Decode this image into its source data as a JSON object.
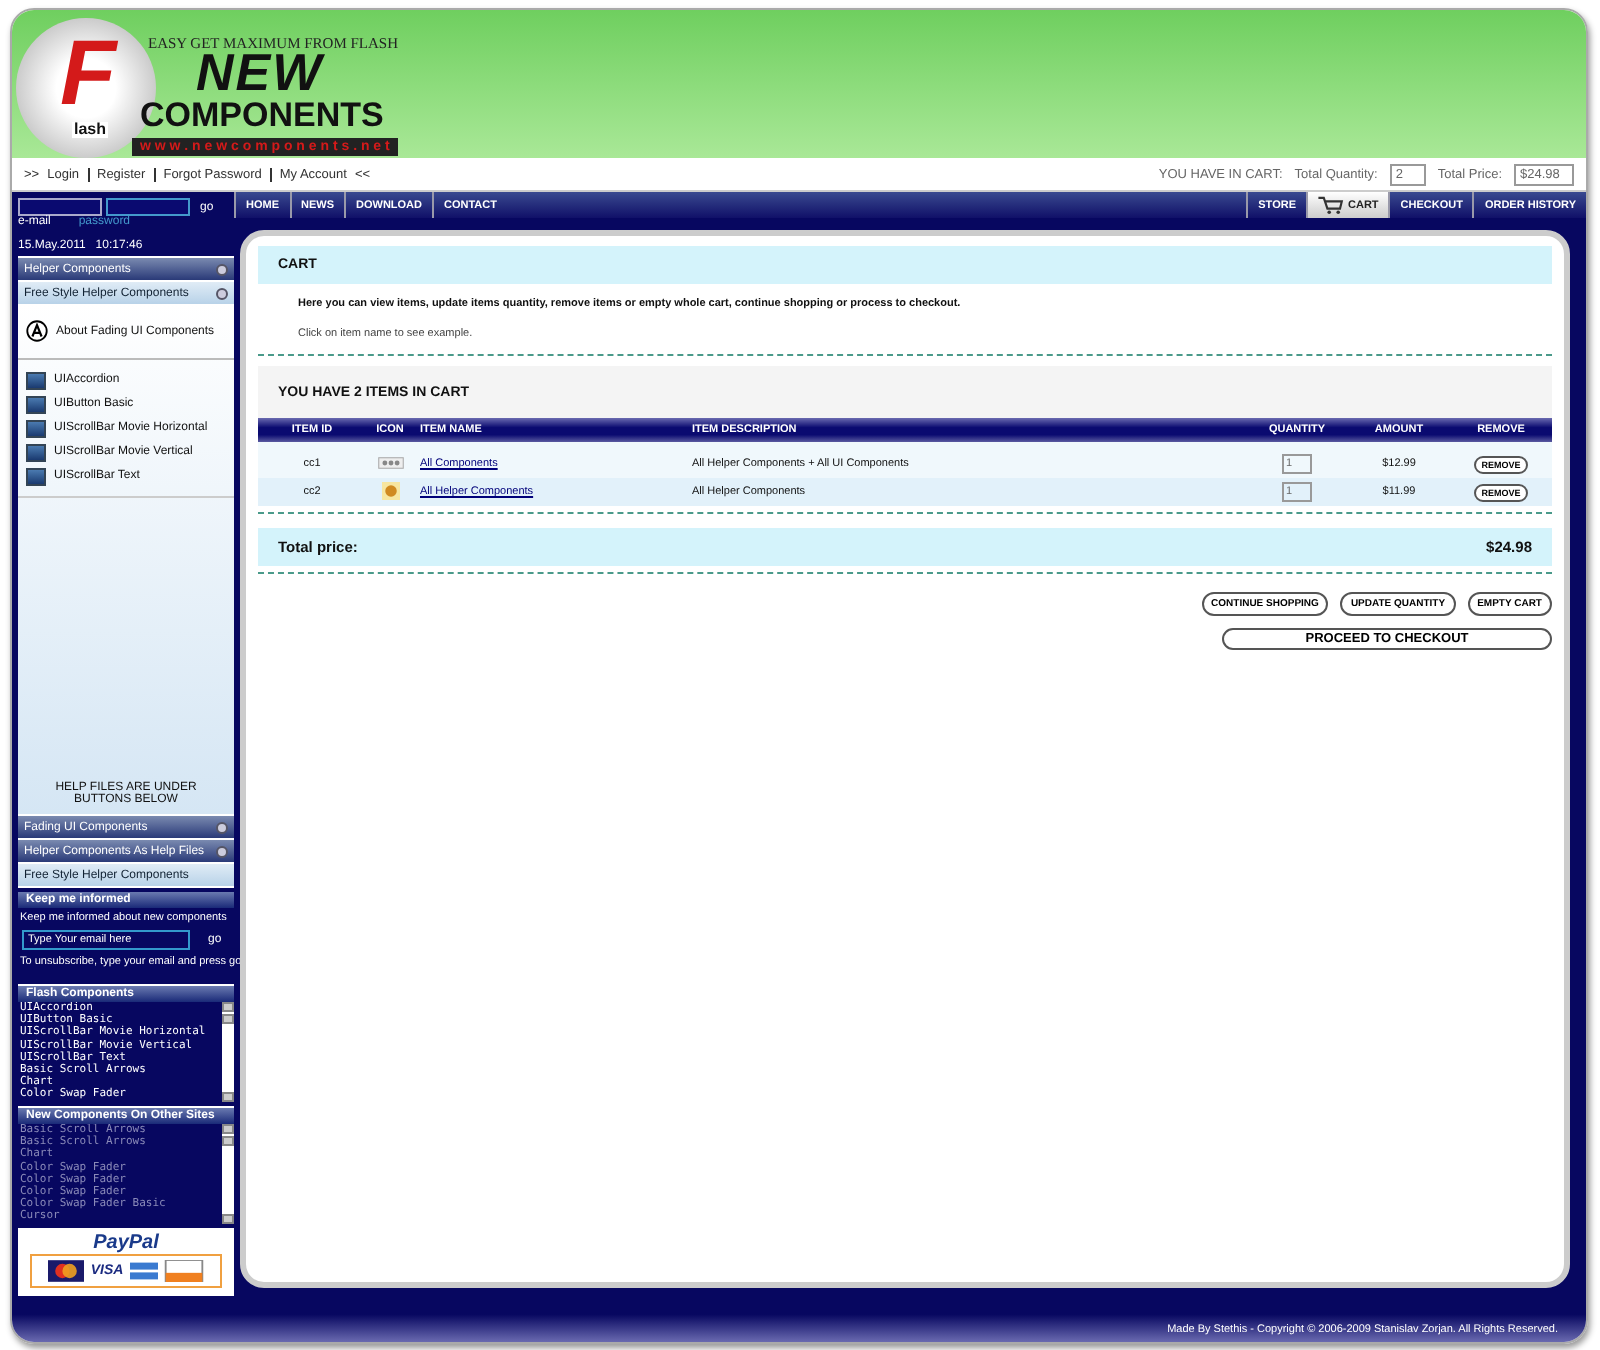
{
  "header": {
    "tagline": "EASY GET MAXIMUM FROM FLASH",
    "logo_letter": "F",
    "logo_small": "lash",
    "logo_new": "NEW",
    "logo_name": "COMPONENTS",
    "logo_url": "w w w . n e w c o m p o n e n t s . n e t"
  },
  "top_links": {
    "open": ">>",
    "links": [
      "Login",
      "Register",
      "Forgot Password",
      "My Account"
    ],
    "close": "<<",
    "cart_label": "YOU HAVE IN CART:",
    "quantity_label": "Total Quantity:",
    "quantity": "2",
    "price_label": "Total Price:",
    "price": "$24.98"
  },
  "login": {
    "email_label": "e-mail",
    "password_label": "password",
    "go": "go"
  },
  "nav": {
    "left": [
      "HOME",
      "NEWS",
      "DOWNLOAD",
      "CONTACT"
    ],
    "right": [
      {
        "label": "STORE",
        "kind": "text",
        "selected": false
      },
      {
        "label": "CART",
        "kind": "cart",
        "selected": true
      },
      {
        "label": "CHECKOUT",
        "kind": "text",
        "selected": false
      },
      {
        "label": "ORDER HISTORY",
        "kind": "text",
        "selected": false
      }
    ]
  },
  "sidebar": {
    "date": "15.May.2011   10:17:46",
    "top_panels": [
      {
        "label": "Helper Components",
        "selected": false
      },
      {
        "label": "Free Style Helper Components",
        "selected": true
      }
    ],
    "about": "About Fading UI Components",
    "items": [
      "UIAccordion",
      "UIButton Basic",
      "UIScrollBar Movie Horizontal",
      "UIScrollBar Movie Vertical",
      "UIScrollBar Text"
    ],
    "help_note": "HELP FILES ARE UNDER BUTTONS BELOW",
    "bottom_panels": [
      {
        "label": "Fading UI Components",
        "selected": false
      },
      {
        "label": "Helper Components As Help Files",
        "selected": false
      },
      {
        "label": "Free Style Helper Components",
        "selected": true
      }
    ],
    "newsletter": {
      "title": "Keep me informed",
      "text": "Keep me informed about new components",
      "value": "Type Your email here",
      "go": "go",
      "note": "To unsubscribe, type your email and press go"
    },
    "lists": [
      {
        "title": "Flash Components",
        "disabled": false,
        "items": [
          "UIAccordion",
          "UIButton Basic",
          "UIScrollBar Movie Horizontal",
          "UIScrollBar Movie Vertical",
          "UIScrollBar Text",
          "Basic Scroll Arrows",
          "Chart",
          "Color Swap Fader"
        ]
      },
      {
        "title": "New Components On Other Sites",
        "disabled": true,
        "items": [
          "Basic Scroll Arrows",
          "Basic Scroll Arrows",
          "Chart",
          "Color Swap Fader",
          "Color Swap Fader",
          "Color Swap Fader",
          "Color Swap Fader Basic",
          "Cursor"
        ]
      }
    ],
    "paypal": {
      "title": "PayPal",
      "visa": "VISA"
    }
  },
  "cart": {
    "title": "CART",
    "intro": "Here you can view items, update items quantity, remove items or empty whole cart,  continue shopping or  process to checkout.",
    "note": "Click on item name to see example.",
    "count": "YOU HAVE 2 ITEMS IN CART",
    "columns": [
      "ITEM ID",
      "ICON",
      "ITEM NAME",
      "ITEM DESCRIPTION",
      "QUANTITY",
      "AMOUNT",
      "REMOVE"
    ],
    "rows": [
      {
        "id": "cc1",
        "kind": "bundle",
        "name": "All Components",
        "description": "All Helper Components + All UI Components",
        "quantity": "1",
        "amount": "$12.99",
        "remove": "REMOVE"
      },
      {
        "id": "cc2",
        "kind": "helper",
        "name": "All Helper Components",
        "description": "All Helper Components",
        "quantity": "1",
        "amount": "$11.99",
        "remove": "REMOVE"
      }
    ],
    "total_label": "Total price:",
    "total": "$24.98",
    "buttons": [
      "CONTINUE SHOPPING",
      "UPDATE QUANTITY",
      "EMPTY CART"
    ],
    "checkout": "PROCEED TO CHECKOUT"
  },
  "footer": "Made By Stethis - Copyright © 2006-2009 Stanislav Zorjan. All Rights Reserved."
}
